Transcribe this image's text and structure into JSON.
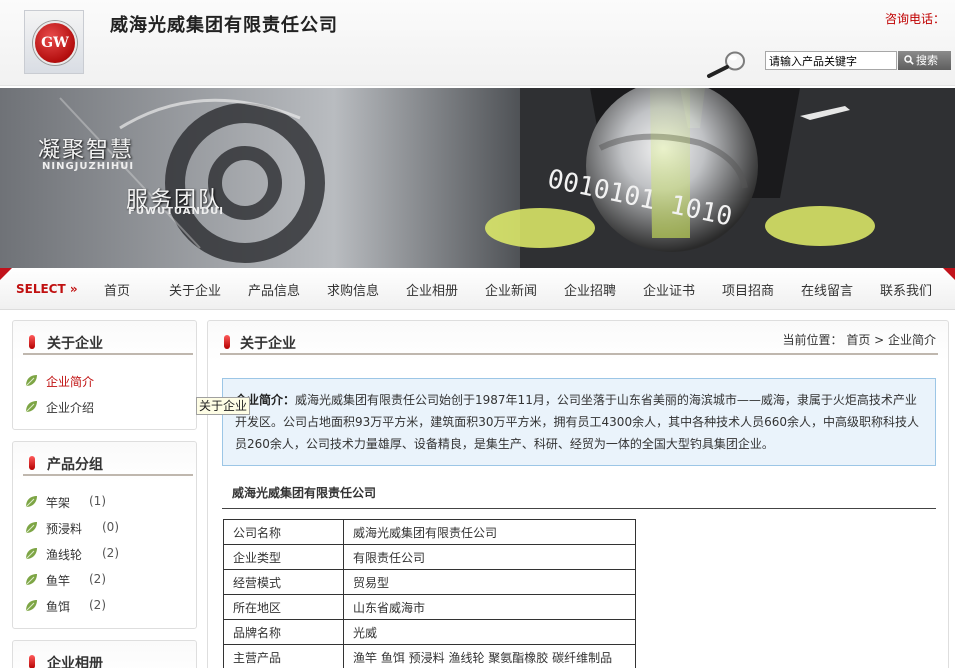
{
  "header": {
    "logo_text": "GW",
    "site_title": "威海光威集团有限责任公司",
    "hotline_label": "咨询电话：",
    "search": {
      "placeholder": "请输入产品关键字",
      "button_label": "搜索"
    }
  },
  "banner": {
    "slogan1_cn": "凝聚智慧",
    "slogan1_en": "NINGJUZHIHUI",
    "slogan2_cn": "服务团队",
    "slogan2_en": "FUWUTUANDUI",
    "binary_text": "0010101 1010"
  },
  "nav": {
    "select_label": "SELECT »",
    "items": [
      "首页",
      "关于企业",
      "产品信息",
      "求购信息",
      "企业相册",
      "企业新闻",
      "企业招聘",
      "企业证书",
      "项目招商",
      "在线留言",
      "联系我们"
    ]
  },
  "sidebar": {
    "about": {
      "title": "关于企业",
      "items": [
        "企业简介",
        "企业介绍"
      ]
    },
    "products": {
      "title": "产品分组",
      "items": [
        {
          "label": "竿架",
          "count": "(1)"
        },
        {
          "label": "预浸料",
          "count": "(0)"
        },
        {
          "label": "渔线轮",
          "count": "(2)"
        },
        {
          "label": "鱼竿",
          "count": "(2)"
        },
        {
          "label": "鱼饵",
          "count": "(2)"
        }
      ]
    },
    "album": {
      "title": "企业相册"
    }
  },
  "tooltip": "关于企业",
  "main": {
    "title": "关于企业",
    "breadcrumb": "当前位置： 首页 > 企业简介",
    "intro_label": "企业简介：",
    "intro_text": "威海光威集团有限责任公司始创于1987年11月，公司坐落于山东省美丽的海滨城市——威海，隶属于火炬高技术产业开发区。公司占地面积93万平方米，建筑面积30万平方米，拥有员工4300余人，其中各种技术人员660余人，中高级职称科技人员260余人，公司技术力量雄厚、设备精良，是集生产、科研、经贸为一体的全国大型钓具集团企业。",
    "company_heading": "威海光威集团有限责任公司",
    "info_rows": [
      {
        "key": "公司名称",
        "value": "威海光威集团有限责任公司"
      },
      {
        "key": "企业类型",
        "value": "有限责任公司"
      },
      {
        "key": "经营模式",
        "value": "贸易型"
      },
      {
        "key": "所在地区",
        "value": "山东省威海市"
      },
      {
        "key": "品牌名称",
        "value": "光威"
      },
      {
        "key": "主营产品",
        "value": "渔竿 鱼饵 预浸料 渔线轮 聚氨酯橡胶 碳纤维制品"
      }
    ]
  },
  "colors": {
    "accent_red": "#c01010",
    "intro_bg": "#eaf3fb",
    "intro_border": "#9cc6e6"
  }
}
